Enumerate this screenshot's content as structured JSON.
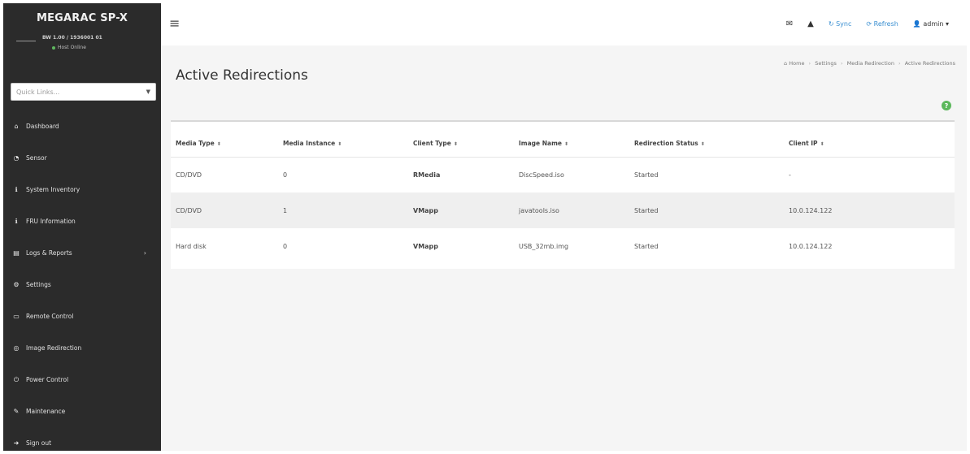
{
  "sidebar": {
    "brand": "MEGARAC SP-X",
    "host_id": "BW 1.00 / 1936001 01",
    "host_status": "Host Online",
    "quick_links_placeholder": "Quick Links...",
    "items": [
      {
        "label": "Dashboard",
        "icon": "home-icon",
        "glyph": "⌂"
      },
      {
        "label": "Sensor",
        "icon": "sensor-icon",
        "glyph": "◔"
      },
      {
        "label": "System Inventory",
        "icon": "info-icon",
        "glyph": "ℹ"
      },
      {
        "label": "FRU Information",
        "icon": "info-icon",
        "glyph": "ℹ"
      },
      {
        "label": "Logs & Reports",
        "icon": "chart-icon",
        "glyph": "▤"
      },
      {
        "label": "Settings",
        "icon": "gear-icon",
        "glyph": "⚙"
      },
      {
        "label": "Remote Control",
        "icon": "monitor-icon",
        "glyph": "▭"
      },
      {
        "label": "Image Redirection",
        "icon": "disc-icon",
        "glyph": "◎"
      },
      {
        "label": "Power Control",
        "icon": "power-icon",
        "glyph": "⏻"
      },
      {
        "label": "Maintenance",
        "icon": "wrench-icon",
        "glyph": "✎"
      },
      {
        "label": "Sign out",
        "icon": "signout-icon",
        "glyph": "➜"
      }
    ]
  },
  "topbar": {
    "sync_label": "Sync",
    "refresh_label": "Refresh",
    "user_label": "admin"
  },
  "page": {
    "title": "Active Redirections",
    "breadcrumb": [
      "Home",
      "Settings",
      "Media Redirection",
      "Active Redirections"
    ]
  },
  "table": {
    "headers": [
      "Media Type",
      "Media Instance",
      "Client Type",
      "Image Name",
      "Redirection Status",
      "Client IP"
    ],
    "rows": [
      [
        "CD/DVD",
        "0",
        "RMedia",
        "DiscSpeed.iso",
        "Started",
        "-"
      ],
      [
        "CD/DVD",
        "1",
        "VMapp",
        "javatools.iso",
        "Started",
        "10.0.124.122"
      ],
      [
        "Hard disk",
        "0",
        "VMapp",
        "USB_32mb.img",
        "Started",
        "10.0.124.122"
      ]
    ]
  },
  "colors": {
    "sidebar_bg": "#2b2b2b",
    "accent_blue": "#3a8fd1",
    "help_green": "#5cb85c",
    "status_online": "#5fb85f"
  }
}
